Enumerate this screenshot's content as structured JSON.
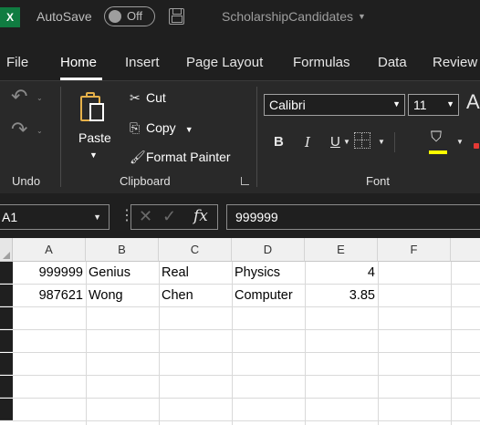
{
  "titlebar": {
    "app_icon": "X",
    "autosave_label": "AutoSave",
    "toggle_state": "Off",
    "filename": "ScholarshipCandidates",
    "filename_caret": "⌄"
  },
  "tabs": [
    "File",
    "Home",
    "Insert",
    "Page Layout",
    "Formulas",
    "Data",
    "Review"
  ],
  "active_tab": "Home",
  "ribbon": {
    "undo_group": {
      "label": "Undo",
      "undo_icon": "undo-icon",
      "redo_icon": "redo-icon"
    },
    "clipboard": {
      "label": "Clipboard",
      "paste": "Paste",
      "cut": "Cut",
      "copy": "Copy",
      "format_painter": "Format Painter"
    },
    "font": {
      "label": "Font",
      "font_name": "Calibri",
      "font_size": "11",
      "bold": "B",
      "italic": "I",
      "underline": "U",
      "grow": "A"
    }
  },
  "formula_bar": {
    "name_box": "A1",
    "fx": "fx",
    "value": "999999"
  },
  "sheet": {
    "columns": [
      "A",
      "B",
      "C",
      "D",
      "E",
      "F"
    ],
    "rows": [
      [
        "999999",
        "Genius",
        "Real",
        "Physics",
        "4",
        ""
      ],
      [
        "987621",
        "Wong",
        "Chen",
        "Computer",
        "3.85",
        ""
      ]
    ]
  },
  "colors": {
    "background": "#1f1f1f",
    "ribbon": "#292929",
    "excel_green": "#107c41",
    "fill_color": "#ffff00",
    "font_color": "#e53935"
  }
}
